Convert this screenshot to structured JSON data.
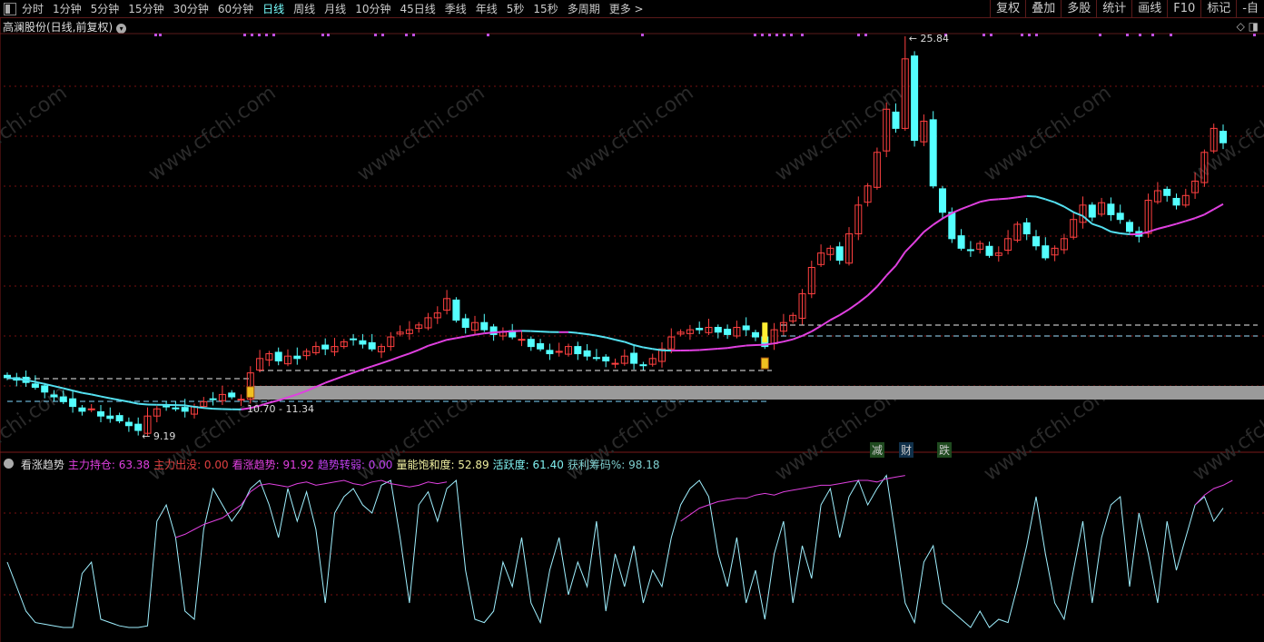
{
  "toolbar": {
    "periods": [
      "分时",
      "1分钟",
      "5分钟",
      "15分钟",
      "30分钟",
      "60分钟",
      "日线",
      "周线",
      "月线",
      "10分钟",
      "45日线",
      "季线",
      "年线",
      "5秒",
      "15秒",
      "多周期",
      "更多 >"
    ],
    "active": "日线",
    "right": [
      "复权",
      "叠加",
      "多股",
      "统计",
      "画线",
      "F10",
      "标记",
      "-自"
    ]
  },
  "title": "高澜股份(日线,前复权)",
  "top_icons": [
    "◇",
    "◨"
  ],
  "watermark": "www.cfchi.com",
  "price_labels": {
    "high": "25.84",
    "low": "9.19",
    "range": "10.70 - 11.34"
  },
  "signals": [
    {
      "text": "减",
      "color": "#7ddc6a"
    },
    {
      "text": "财",
      "color": "#7fd7ff"
    },
    {
      "text": "跌",
      "color": "#7ddc6a"
    }
  ],
  "indicator": {
    "name": "看涨趋势",
    "items": [
      {
        "label": "主力持仓:",
        "value": "63.38",
        "color": "#e040e0"
      },
      {
        "label": "主力出没:",
        "value": "0.00",
        "color": "#e04040"
      },
      {
        "label": "看涨趋势:",
        "value": "91.92",
        "color": "#e040e0"
      },
      {
        "label": "趋势转弱:",
        "value": "0.00",
        "color": "#c040f0"
      },
      {
        "label": "量能饱和度:",
        "value": "52.89",
        "color": "#f0f0a0"
      },
      {
        "label": "活跃度:",
        "value": "61.40",
        "color": "#7ff0f0"
      },
      {
        "label": "获利筹码%:",
        "value": "98.18",
        "color": "#7fd0d0"
      }
    ]
  },
  "colors": {
    "up": "#ff4040",
    "down": "#54ffff",
    "ma_up": "#e040e0",
    "ma_down": "#54e0f0",
    "grid": "#7a1010",
    "osc": "#9ff0ff",
    "osc2": "#e040e0"
  },
  "chart_data": {
    "type": "candlestick",
    "closes": [
      11.6,
      11.5,
      11.4,
      11.2,
      11.0,
      10.8,
      10.6,
      10.4,
      10.2,
      10.3,
      10.0,
      9.9,
      9.8,
      9.6,
      9.4,
      10.0,
      10.3,
      10.4,
      10.3,
      10.2,
      10.4,
      10.6,
      10.7,
      10.9,
      10.8,
      10.7,
      11.8,
      12.4,
      12.6,
      12.3,
      12.5,
      12.4,
      12.7,
      12.9,
      12.8,
      12.9,
      13.1,
      13.2,
      13.0,
      12.8,
      12.9,
      13.3,
      13.5,
      13.6,
      13.8,
      14.1,
      14.3,
      14.9,
      14.0,
      13.7,
      13.9,
      13.6,
      13.4,
      13.5,
      13.3,
      13.2,
      12.9,
      12.8,
      12.6,
      12.7,
      12.9,
      12.6,
      12.5,
      12.4,
      12.3,
      12.2,
      12.5,
      12.2,
      12.1,
      12.4,
      12.8,
      13.3,
      13.5,
      13.6,
      13.6,
      13.7,
      13.5,
      13.4,
      13.7,
      13.6,
      13.3,
      12.9,
      13.6,
      13.9,
      14.2,
      15.1,
      16.2,
      16.8,
      17.0,
      16.5,
      17.6,
      18.8,
      19.6,
      21.0,
      22.8,
      22.0,
      24.9,
      21.5,
      22.3,
      19.6,
      18.5,
      17.4,
      17.0,
      16.9,
      17.2,
      16.7,
      16.8,
      17.4,
      18.0,
      17.6,
      17.1,
      16.6,
      17.0,
      17.4,
      18.2,
      18.8,
      18.3,
      18.9,
      18.4,
      18.2,
      17.7,
      17.5,
      19.0,
      19.4,
      19.2,
      18.8,
      19.2,
      19.8,
      21.0,
      22.0,
      21.4
    ],
    "price_high": 25.84,
    "price_low": 9.19,
    "oscillator": [
      45,
      30,
      15,
      8,
      7,
      6,
      5,
      5,
      38,
      45,
      10,
      8,
      6,
      5,
      5,
      6,
      70,
      80,
      60,
      15,
      10,
      65,
      90,
      80,
      70,
      78,
      90,
      95,
      80,
      60,
      90,
      70,
      88,
      65,
      20,
      75,
      85,
      90,
      80,
      75,
      92,
      95,
      60,
      20,
      80,
      88,
      70,
      90,
      95,
      40,
      10,
      8,
      15,
      45,
      30,
      60,
      20,
      8,
      40,
      60,
      25,
      45,
      30,
      70,
      15,
      50,
      30,
      55,
      20,
      40,
      30,
      60,
      80,
      90,
      95,
      85,
      50,
      30,
      60,
      20,
      40,
      10,
      50,
      70,
      20,
      55,
      35,
      80,
      90,
      60,
      85,
      95,
      80,
      90,
      98,
      60,
      20,
      8,
      45,
      55,
      20,
      15,
      10,
      5,
      15,
      5,
      10,
      8,
      30,
      55,
      85,
      50,
      20,
      10,
      40,
      70,
      20,
      60,
      80,
      85,
      30,
      75,
      50,
      20,
      70,
      40,
      60,
      80,
      85,
      70,
      78
    ],
    "oscillator2": [
      {
        "start": 18,
        "values": [
          60,
          62,
          65,
          68,
          70,
          72,
          76,
          80,
          88,
          92,
          93,
          92,
          91,
          93,
          94,
          92,
          93,
          94,
          95,
          93,
          92,
          94,
          95,
          93,
          92,
          91,
          92,
          94,
          93,
          94
        ]
      },
      {
        "start": 72,
        "values": [
          70,
          74,
          78,
          80,
          82,
          83,
          84,
          84,
          86,
          87,
          86,
          88,
          89,
          90,
          91,
          92,
          92,
          93,
          94,
          95,
          95,
          94,
          96,
          97,
          98
        ]
      },
      {
        "start": 127,
        "values": [
          80,
          86,
          90,
          92,
          95
        ]
      }
    ]
  }
}
